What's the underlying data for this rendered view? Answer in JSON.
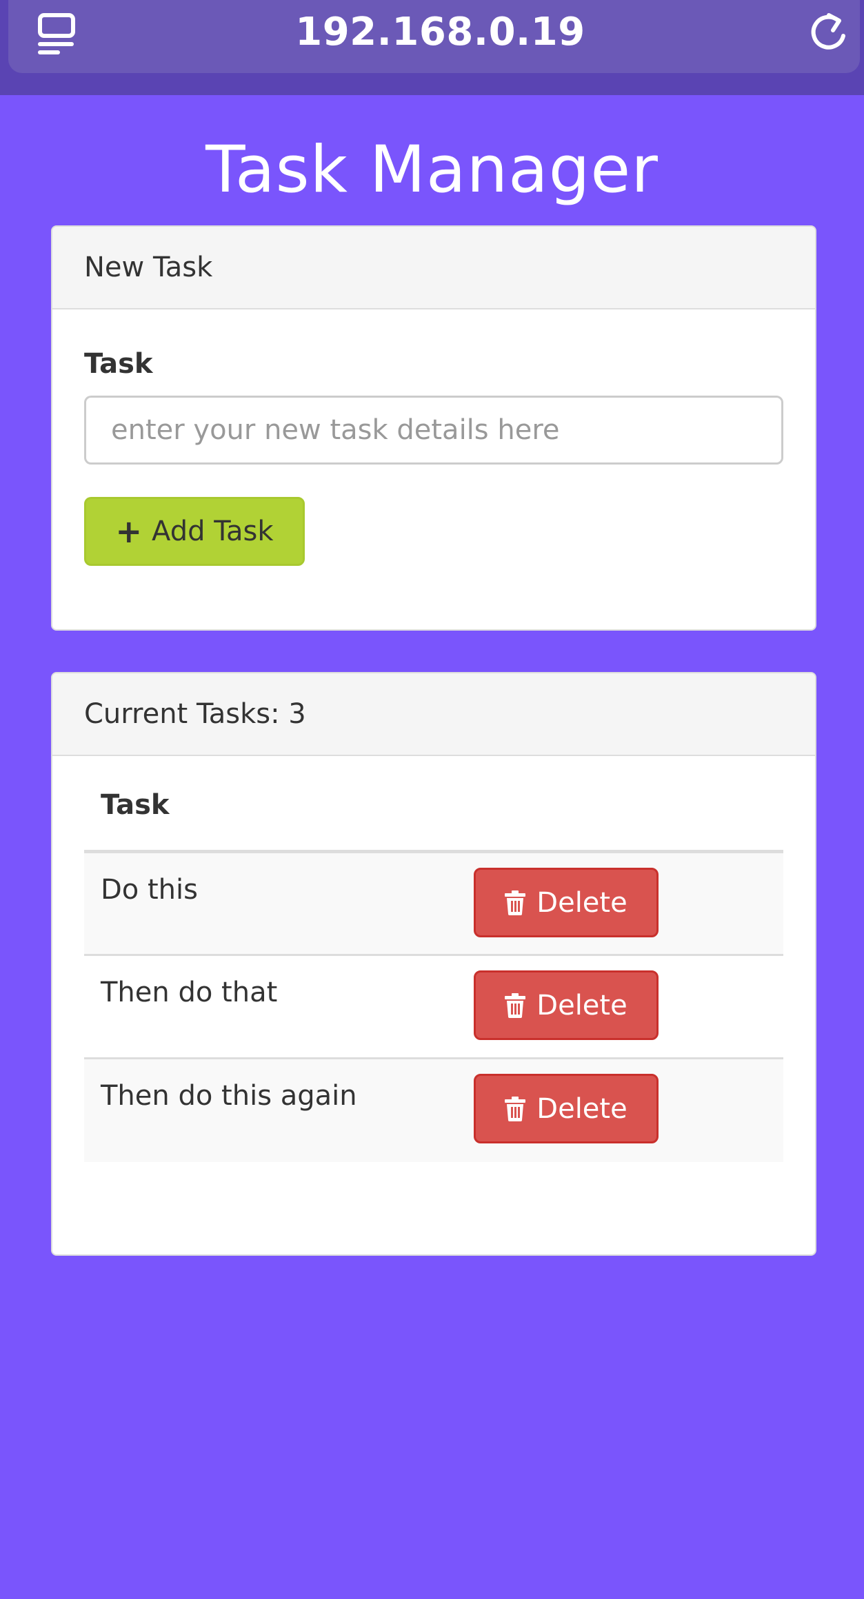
{
  "browser": {
    "address": "192.168.0.19",
    "tabs_icon": "tabs-icon",
    "reload_icon": "reload-icon"
  },
  "page": {
    "title": "Task Manager"
  },
  "new_task": {
    "heading": "New Task",
    "field_label": "Task",
    "input_value": "",
    "input_placeholder": "enter your new task details here",
    "add_button_label": "Add Task",
    "add_button_icon": "plus-icon"
  },
  "current_tasks": {
    "heading": "Current Tasks: 3",
    "column_header": "Task",
    "delete_icon": "trash-icon",
    "rows": [
      {
        "task": "Do this",
        "action_label": "Delete"
      },
      {
        "task": "Then do that",
        "action_label": "Delete"
      },
      {
        "task": "Then do this again",
        "action_label": "Delete"
      }
    ]
  },
  "colors": {
    "background": "#7a55fc",
    "browser_bar": "#6b59b7",
    "add_button": "#b1d235",
    "delete_button": "#d9534f",
    "panel_heading": "#f5f5f5"
  }
}
